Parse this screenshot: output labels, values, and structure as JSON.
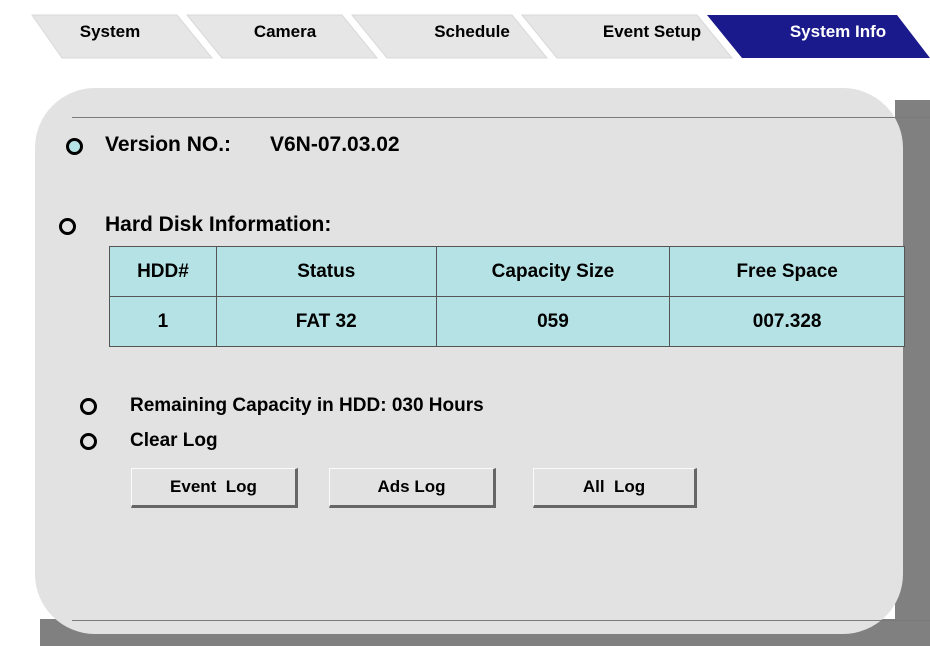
{
  "tabs": [
    {
      "label": "System",
      "active": false
    },
    {
      "label": "Camera",
      "active": false
    },
    {
      "label": "Schedule",
      "active": false
    },
    {
      "label": "Event Setup",
      "active": false
    },
    {
      "label": "System Info",
      "active": true
    }
  ],
  "colors": {
    "tab_inactive": "#e6e6e6",
    "tab_active": "#1a1a8c",
    "panel": "#e2e2e2",
    "table_fill": "#b5e2e4",
    "shadow": "#808080"
  },
  "version": {
    "label": "Version NO.:",
    "value": "V6N-07.03.02"
  },
  "hard_disk": {
    "heading": "Hard Disk Information:",
    "columns": [
      "HDD#",
      "Status",
      "Capacity Size",
      "Free Space"
    ],
    "rows": [
      [
        "1",
        "FAT 32",
        "059",
        "007.328"
      ]
    ]
  },
  "remaining": {
    "label": "Remaining Capacity in HDD: 030 Hours"
  },
  "clear_log": {
    "label": "Clear Log"
  },
  "buttons": {
    "event_log": "Event  Log",
    "ads_log": "Ads Log",
    "all_log": "All  Log"
  }
}
